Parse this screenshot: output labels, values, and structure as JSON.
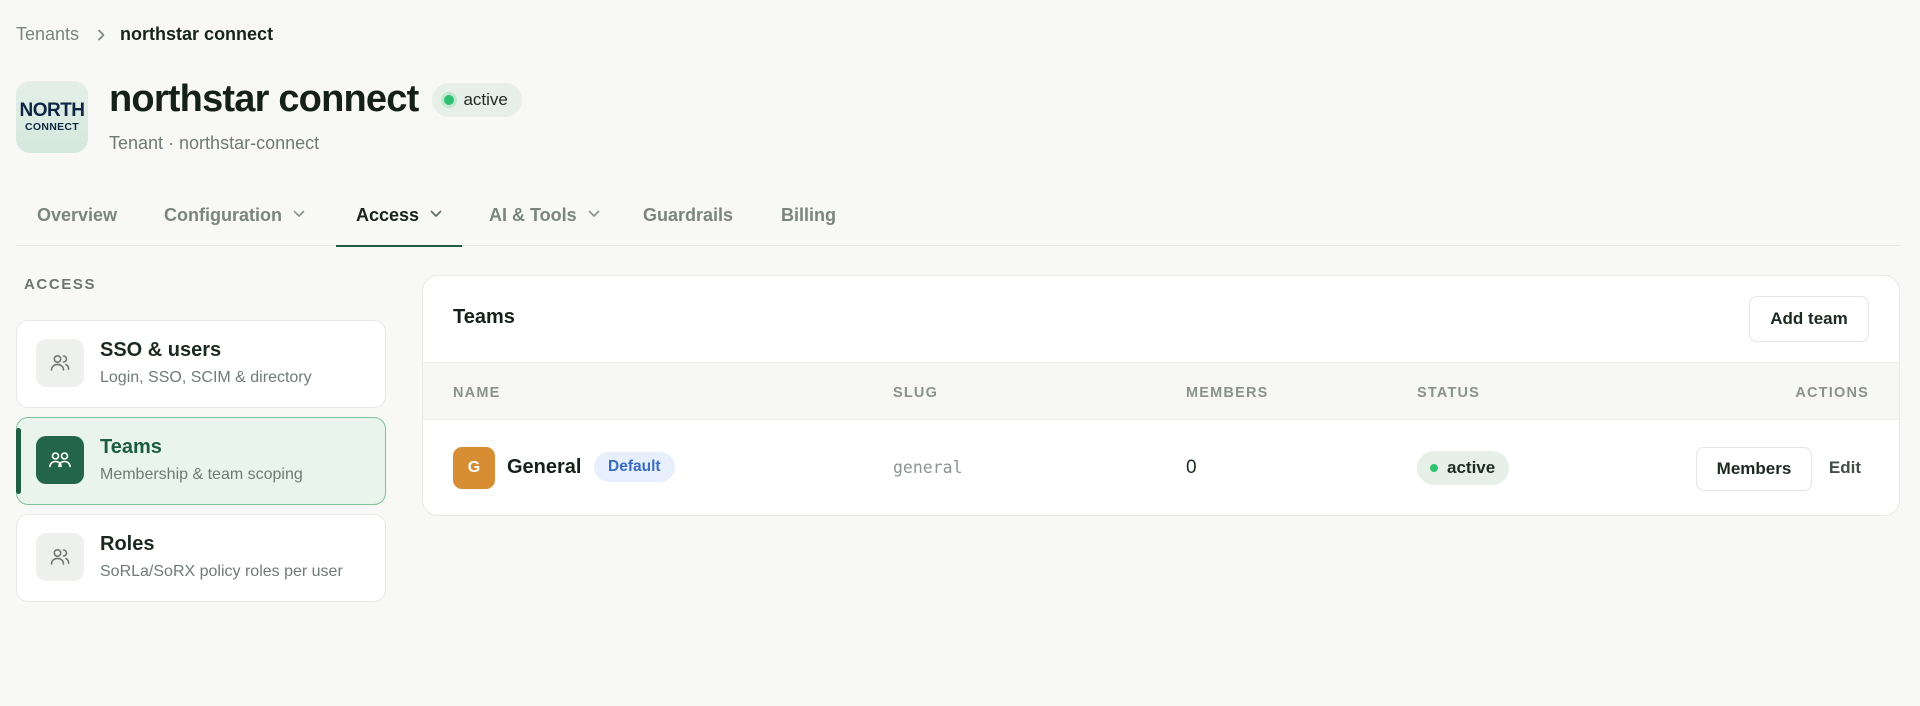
{
  "breadcrumb": {
    "root": "Tenants",
    "current": "northstar connect"
  },
  "header": {
    "logo_line1": "NORTH",
    "logo_line2": "CONNECT",
    "title": "northstar connect",
    "status": "active",
    "subtitle": "Tenant · northstar-connect"
  },
  "tabs": [
    {
      "label": "Overview",
      "has_dropdown": false
    },
    {
      "label": "Configuration",
      "has_dropdown": true
    },
    {
      "label": "Access",
      "has_dropdown": true,
      "active": true
    },
    {
      "label": "AI & Tools",
      "has_dropdown": true
    },
    {
      "label": "Guardrails",
      "has_dropdown": false
    },
    {
      "label": "Billing",
      "has_dropdown": false
    }
  ],
  "sidebar": {
    "heading": "ACCESS",
    "items": [
      {
        "title": "SSO & users",
        "description": "Login, SSO, SCIM & directory",
        "icon": "users-icon"
      },
      {
        "title": "Teams",
        "description": "Membership & team scoping",
        "icon": "team-icon",
        "active": true
      },
      {
        "title": "Roles",
        "description": "SoRLa/SoRX policy roles per user",
        "icon": "users-icon"
      }
    ]
  },
  "teams_panel": {
    "title": "Teams",
    "add_label": "Add team",
    "columns": {
      "name": "NAME",
      "slug": "SLUG",
      "members": "MEMBERS",
      "status": "STATUS",
      "actions": "ACTIONS"
    },
    "rows": [
      {
        "avatar_letter": "G",
        "name": "General",
        "badge": "Default",
        "slug": "general",
        "members": "0",
        "status": "active",
        "members_action": "Members",
        "edit_action": "Edit"
      }
    ]
  },
  "colors": {
    "accent": "#1f5e43",
    "active_dot": "#2ec26f",
    "avatar": "#d78d33",
    "badge_text": "#3a6dc1"
  }
}
